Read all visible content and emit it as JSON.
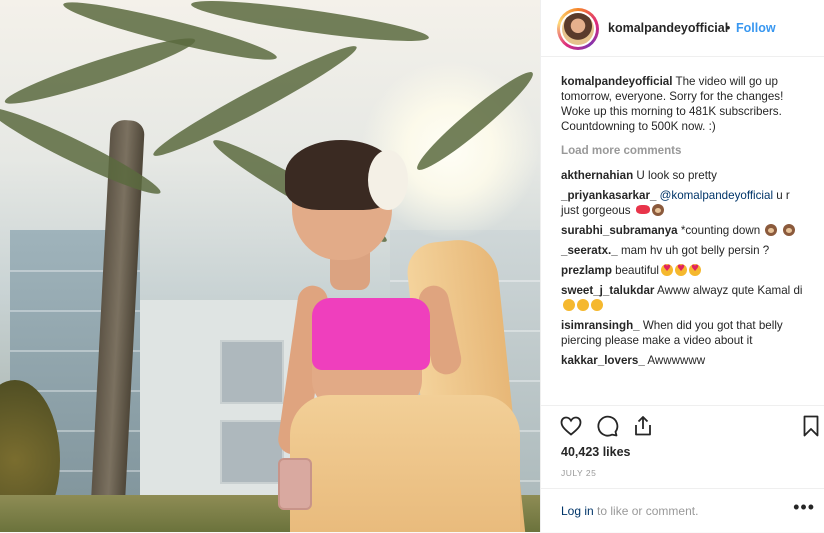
{
  "post": {
    "username": "komalpandeyofficial",
    "separator": "•",
    "follow_label": "Follow",
    "caption_text": "The video will go up tomorrow, everyone. Sorry for the changes! Woke up this morning to 481K subscribers. Countdowning to 500K now. :)",
    "load_more": "Load more comments",
    "comments": [
      {
        "user": "akthernahian",
        "text": "U look so pretty"
      },
      {
        "user": "_priyankasarkar_",
        "mention": "@komalpandeyofficial",
        "text": "u r just gorgeous"
      },
      {
        "user": "surabhi_subramanya",
        "text": "*counting down"
      },
      {
        "user": "_seeratx._",
        "text": "mam hv uh got belly persin ?"
      },
      {
        "user": "prezlamp",
        "text": "beautiful"
      },
      {
        "user": "sweet_j_talukdar",
        "text": "Awww alwayz qute Kamal di"
      },
      {
        "user": "isimransingh_",
        "text": "When did you got that belly piercing please make a video about it"
      },
      {
        "user": "kakkar_lovers_",
        "text": "Awwwwww"
      }
    ],
    "likes": "40,423 likes",
    "date": "JULY 25",
    "footer_login": "Log in",
    "footer_rest": " to like or comment.",
    "more_icon": "•••"
  },
  "icons": [
    "heart-icon",
    "comment-icon",
    "share-icon",
    "bookmark-icon",
    "more-options-icon"
  ],
  "colors": {
    "link": "#3897f0",
    "mention": "#003569",
    "muted": "#999999",
    "text": "#262626"
  }
}
